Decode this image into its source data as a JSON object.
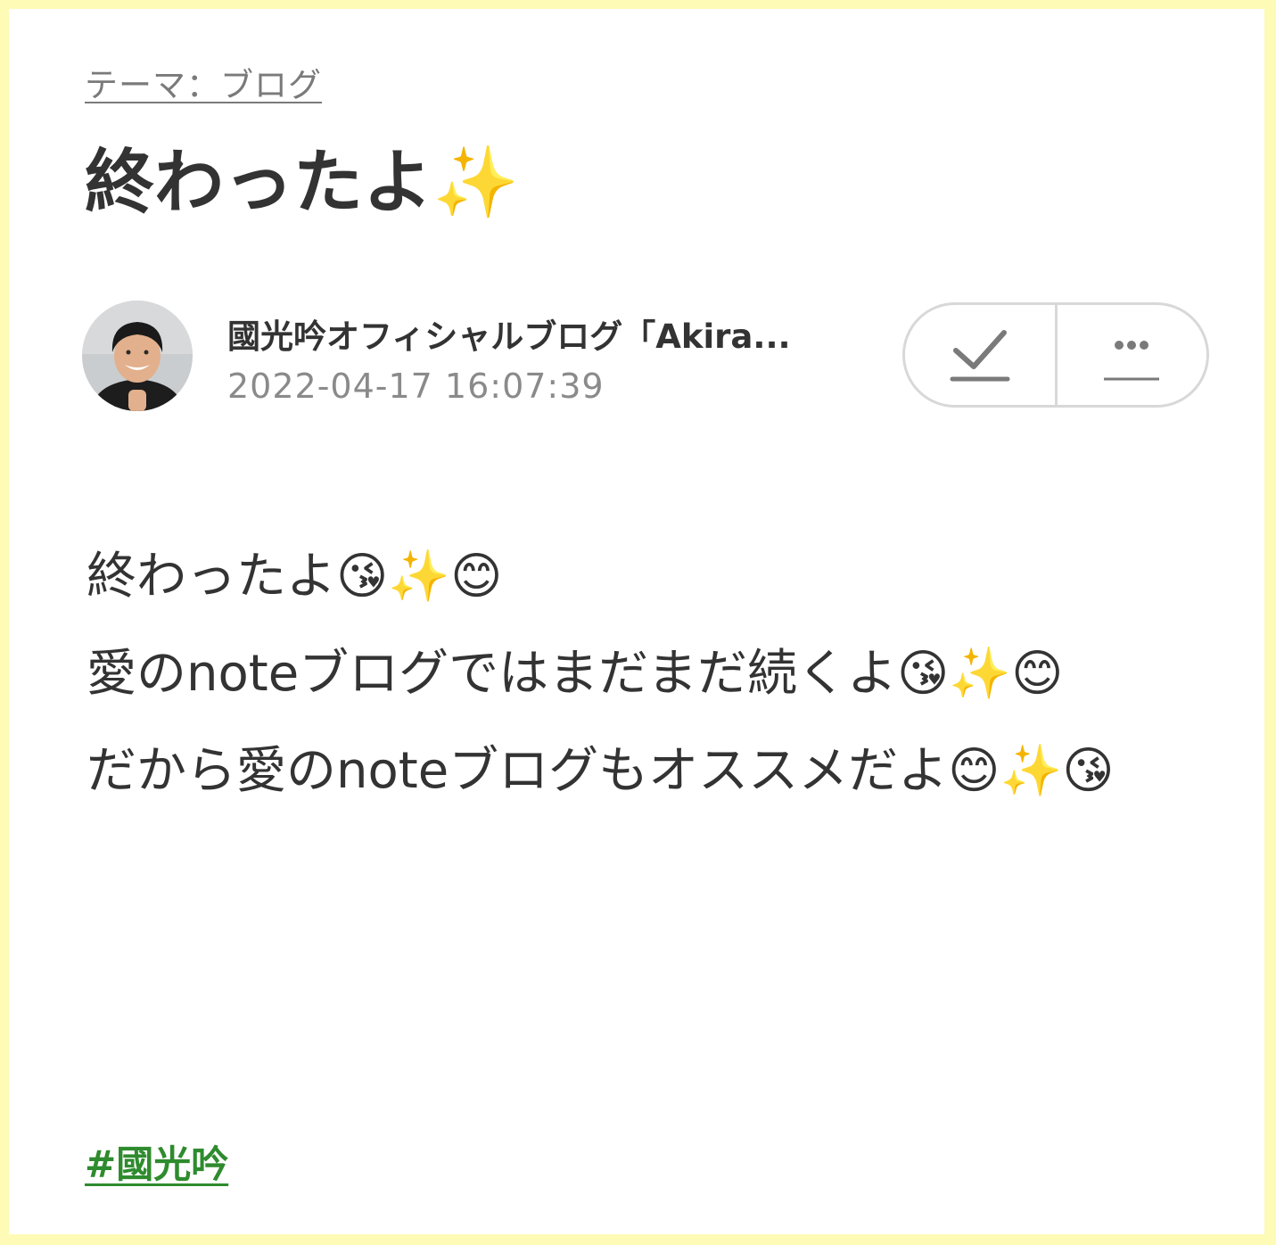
{
  "theme": {
    "label": "テーマ：ブログ"
  },
  "article": {
    "title": "終わったよ✨"
  },
  "author": {
    "name": "國光吟オフィシャルブログ「Akira...",
    "date": "2022-04-17 16:07:39",
    "avatar_icon": "author-photo"
  },
  "actions": {
    "check_icon": "check-icon",
    "more_icon": "more-icon"
  },
  "body": {
    "lines": [
      "終わったよ😘✨😊",
      "愛のnoteブログではまだまだ続くよ😘✨😊",
      "だから愛のnoteブログもオススメだよ😊✨😘"
    ]
  },
  "hashtag": {
    "label": "#國光吟"
  },
  "colors": {
    "page_border": "#fdfbb5",
    "hashtag": "#2e8b2e",
    "text": "#333333",
    "muted": "#8a8a8a"
  }
}
